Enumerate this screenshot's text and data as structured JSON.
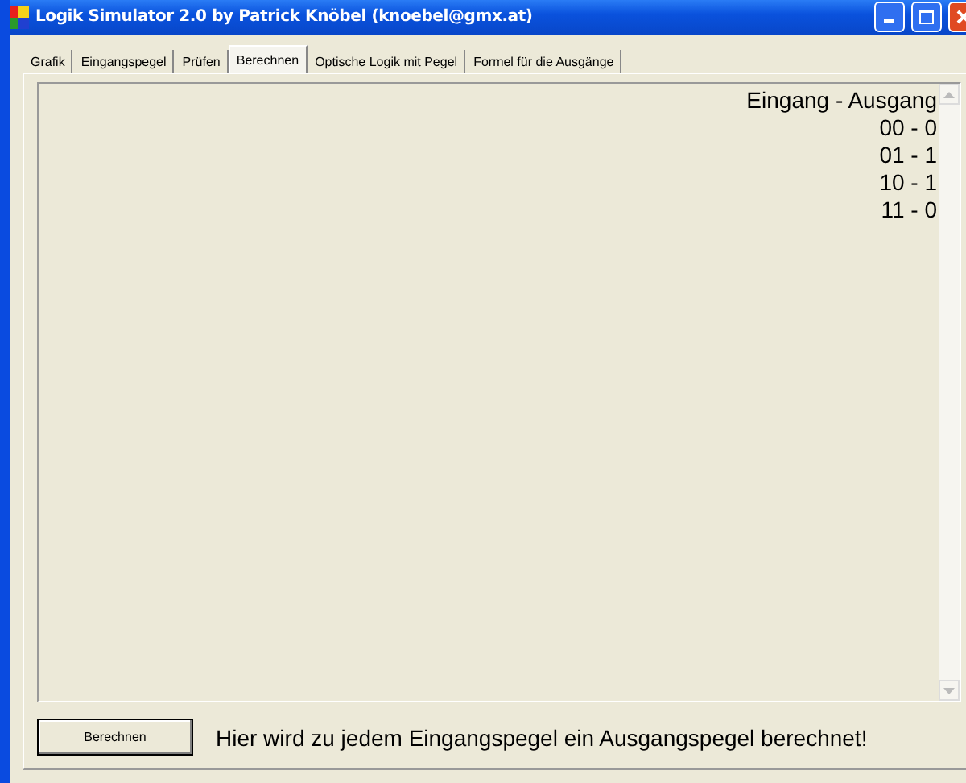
{
  "window": {
    "title": "Logik Simulator 2.0 by Patrick Knöbel (knoebel@gmx.at)"
  },
  "tabs": [
    {
      "label": "Grafik",
      "selected": false
    },
    {
      "label": "Eingangspegel",
      "selected": false
    },
    {
      "label": "Prüfen",
      "selected": false
    },
    {
      "label": "Berechnen",
      "selected": true
    },
    {
      "label": "Optische Logik mit Pegel",
      "selected": false
    },
    {
      "label": "Formel für die Ausgänge",
      "selected": false
    }
  ],
  "output": {
    "lines": [
      "Eingang - Ausgang",
      "00 - 0",
      "01 - 1",
      "10 - 1",
      "11 - 0"
    ]
  },
  "button": {
    "label": "Berechnen"
  },
  "hint": "Hier wird zu jedem Eingangspegel ein Ausgangspegel berechnet!"
}
